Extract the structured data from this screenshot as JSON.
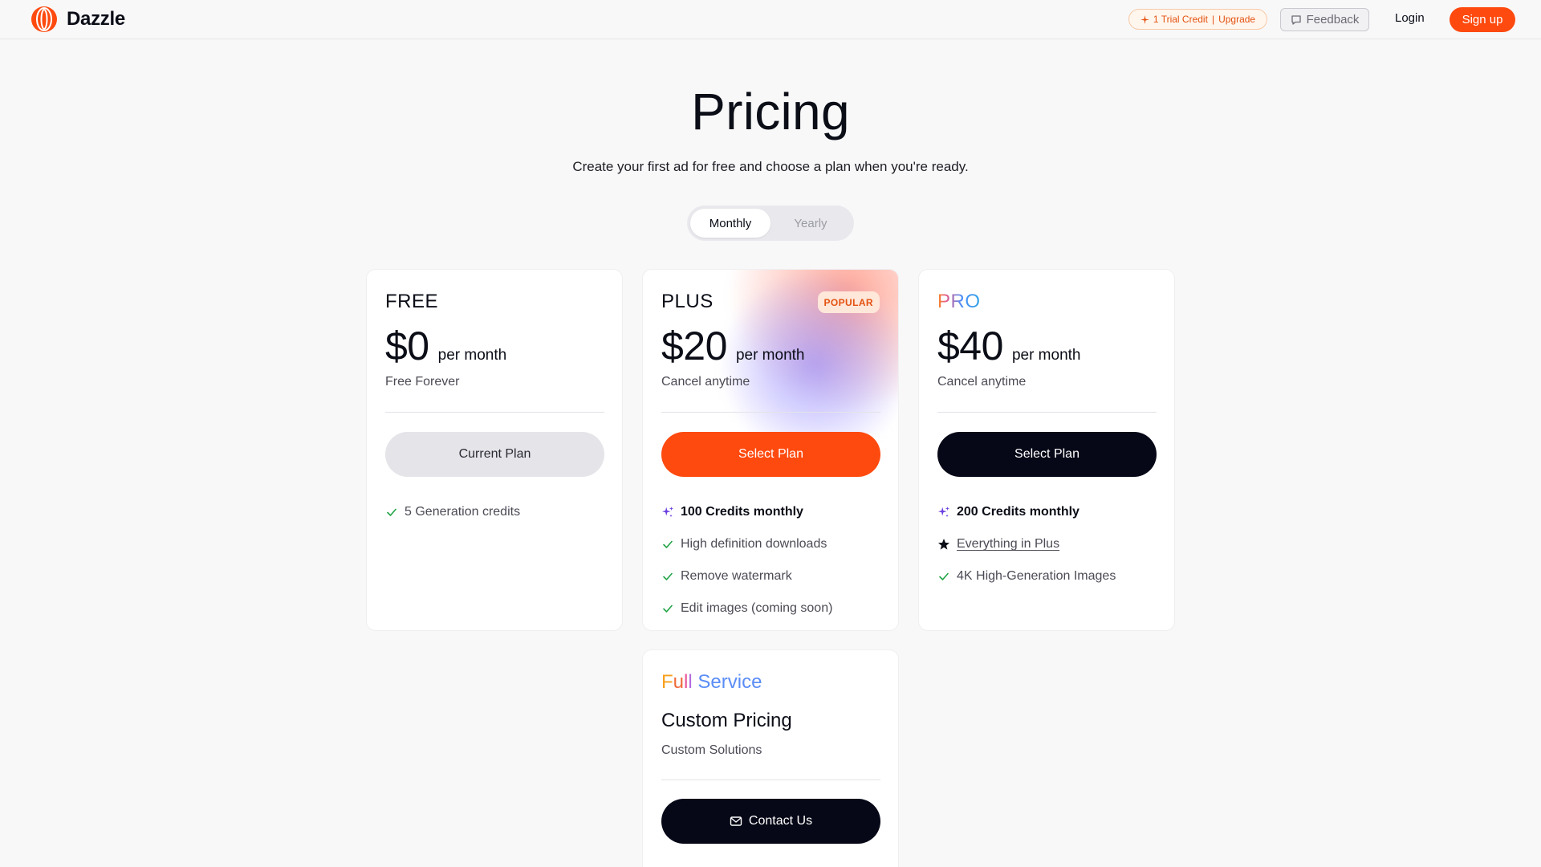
{
  "header": {
    "logo_text": "Dazzle",
    "trial_credit": "1 Trial Credit",
    "separator": "|",
    "upgrade": "Upgrade",
    "feedback": "Feedback",
    "login": "Login",
    "signup": "Sign up"
  },
  "hero": {
    "title": "Pricing",
    "subtitle": "Create your first ad for free and choose a plan when you're ready."
  },
  "billing_toggle": {
    "options": [
      "Monthly",
      "Yearly"
    ],
    "selected": "Monthly"
  },
  "plans": [
    {
      "name": "FREE",
      "price": "$0",
      "period": "per month",
      "note": "Free Forever",
      "cta": "Current Plan",
      "features": [
        "5 Generation credits"
      ]
    },
    {
      "name": "PLUS",
      "badge": "POPULAR",
      "price": "$20",
      "period": "per month",
      "note": "Cancel anytime",
      "cta": "Select Plan",
      "features": [
        "100 Credits monthly",
        "High definition downloads",
        "Remove watermark",
        "Edit images (coming soon)"
      ]
    },
    {
      "name": "PRO",
      "price": "$40",
      "period": "per month",
      "note": "Cancel anytime",
      "cta": "Select Plan",
      "features": [
        "200 Credits monthly",
        "Everything in Plus",
        "4K High-Generation Images"
      ]
    }
  ],
  "full_service": {
    "title_parts": [
      "F",
      "u",
      "l",
      "l",
      "Service"
    ],
    "price": "Custom Pricing",
    "note": "Custom Solutions",
    "cta": "Contact Us"
  },
  "colors": {
    "accent": "#fe4a0f",
    "dark": "#060817",
    "check": "#22a447",
    "sparkle": "#6b3fe0"
  },
  "icons": [
    "logo-icon",
    "sparkle-icon",
    "speech-bubble-icon",
    "check-icon",
    "sparkles-icon",
    "star-icon",
    "mail-icon"
  ]
}
